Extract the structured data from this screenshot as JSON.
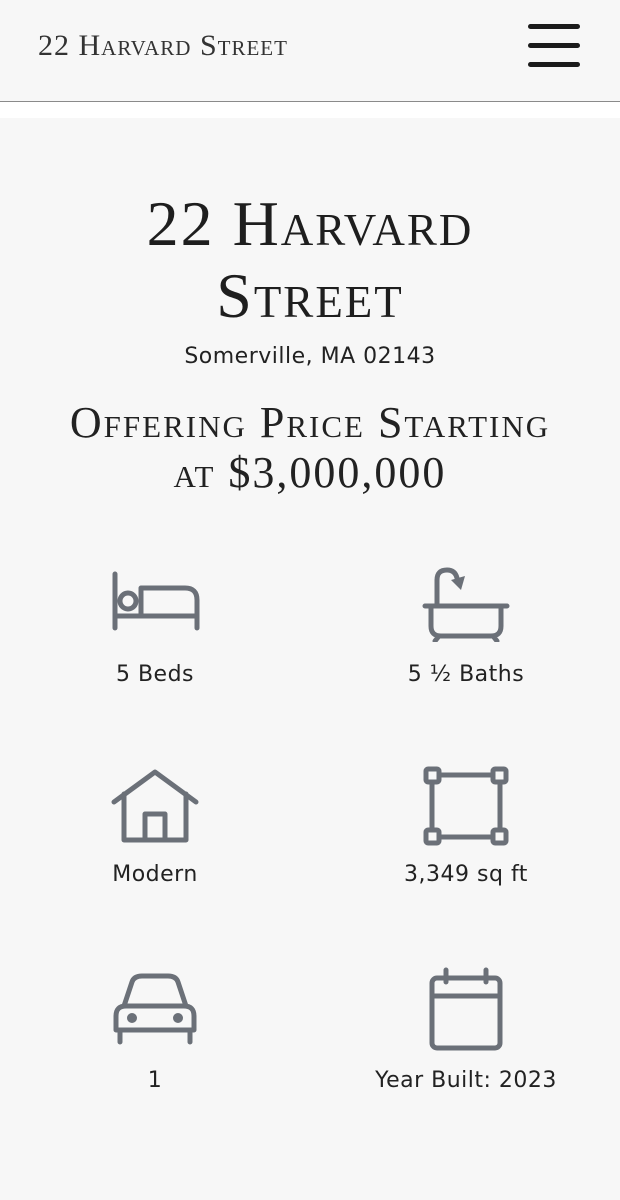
{
  "header": {
    "brand": "22 Harvard Street",
    "menu_icon": "hamburger-menu-icon"
  },
  "listing": {
    "title_line1": "22 Harvard",
    "title_line2": "Street",
    "address": "Somerville, MA 02143",
    "price_line1": "Offering Price Starting",
    "price_line2": "at $3,000,000"
  },
  "features": [
    {
      "icon": "bed-icon",
      "label": "5 Beds"
    },
    {
      "icon": "bathtub-icon",
      "label": "5 ½ Baths"
    },
    {
      "icon": "house-icon",
      "label": "Modern"
    },
    {
      "icon": "floor-area-icon",
      "label": "3,349 sq ft"
    },
    {
      "icon": "car-icon",
      "label": "1"
    },
    {
      "icon": "calendar-icon",
      "label": "Year Built: 2023"
    }
  ],
  "colors": {
    "background": "#f7f7f7",
    "icon": "#6b7078",
    "text": "#222222"
  }
}
